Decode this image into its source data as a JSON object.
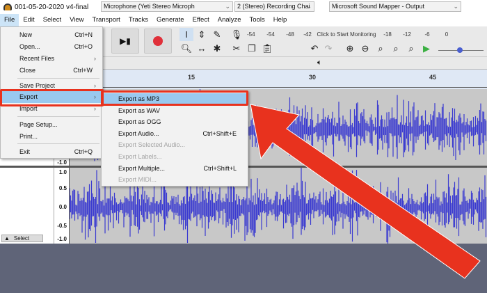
{
  "window": {
    "title": "001-05-20-2020 v4-final"
  },
  "menubar": [
    "File",
    "Edit",
    "Select",
    "View",
    "Transport",
    "Tracks",
    "Generate",
    "Effect",
    "Analyze",
    "Tools",
    "Help"
  ],
  "meter": {
    "labels": [
      "L",
      "R"
    ],
    "ticks": [
      "-54",
      "-48",
      "-42"
    ],
    "monitor": "Click to Start Monitoring",
    "ticks2": [
      "-18",
      "-12",
      "-6",
      "0"
    ]
  },
  "devices": {
    "input": "Microphone (Yeti Stereo Microph",
    "channels": "2 (Stereo) Recording Chai",
    "output": "Microsoft Sound Mapper - Output"
  },
  "ruler": [
    "15",
    "30",
    "45"
  ],
  "track": {
    "scale": [
      "1.0",
      "0.5",
      "0.0",
      "-0.5",
      "-1.0"
    ],
    "select": "Select",
    "waveform_color": "#3a3ad0"
  },
  "file_menu": [
    {
      "label": "New",
      "shortcut": "Ctrl+N"
    },
    {
      "label": "Open...",
      "shortcut": "Ctrl+O"
    },
    {
      "label": "Recent Files",
      "submenu": true
    },
    {
      "label": "Close",
      "shortcut": "Ctrl+W"
    },
    {
      "label": "Save Project",
      "submenu": true
    },
    {
      "label": "Export",
      "submenu": true,
      "highlighted": true
    },
    {
      "label": "Import",
      "submenu": true
    },
    {
      "label": "Page Setup..."
    },
    {
      "label": "Print..."
    },
    {
      "label": "Exit",
      "shortcut": "Ctrl+Q"
    }
  ],
  "export_menu": [
    {
      "label": "Export as MP3",
      "highlighted": true
    },
    {
      "label": "Export as WAV"
    },
    {
      "label": "Export as OGG"
    },
    {
      "label": "Export Audio...",
      "shortcut": "Ctrl+Shift+E"
    },
    {
      "label": "Export Selected Audio...",
      "disabled": true
    },
    {
      "label": "Export Labels...",
      "disabled": true
    },
    {
      "label": "Export Multiple...",
      "shortcut": "Ctrl+Shift+L"
    },
    {
      "label": "Export MIDI...",
      "disabled": true
    }
  ],
  "annotation_color": "#e8321e"
}
